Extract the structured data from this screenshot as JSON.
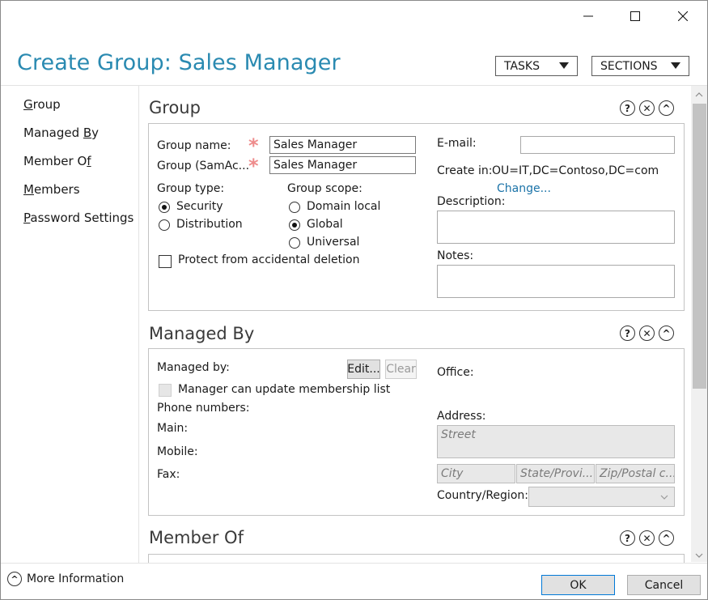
{
  "window": {
    "title": "Create Group: Sales Manager",
    "controls": {
      "minimize": "minimize",
      "maximize": "maximize",
      "close": "close"
    }
  },
  "toolbar": {
    "tasks_label": "TASKS",
    "sections_label": "SECTIONS"
  },
  "nav": {
    "items": [
      {
        "label": "Group",
        "access_key": "G"
      },
      {
        "label": "Managed By",
        "access_key": "B"
      },
      {
        "label": "Member Of",
        "access_key": "f"
      },
      {
        "label": "Members",
        "access_key": "M"
      },
      {
        "label": "Password Settings",
        "access_key": "P"
      }
    ]
  },
  "group_section": {
    "title": "Group",
    "group_name_label": "Group name:",
    "group_name_value": "Sales Manager",
    "samaccount_label": "Group (SamAc...",
    "samaccount_value": "Sales Manager",
    "group_type_label": "Group type:",
    "group_types": [
      "Security",
      "Distribution"
    ],
    "group_type_selected": "Security",
    "group_scope_label": "Group scope:",
    "group_scopes": [
      "Domain local",
      "Global",
      "Universal"
    ],
    "group_scope_selected": "Global",
    "protect_label": "Protect from accidental deletion",
    "protect_checked": false,
    "email_label": "E-mail:",
    "email_value": "",
    "create_in_label": "Create in:",
    "create_in_value": "OU=IT,DC=Contoso,DC=com",
    "change_link": "Change...",
    "description_label": "Description:",
    "notes_label": "Notes:"
  },
  "managed_by_section": {
    "title": "Managed By",
    "managed_by_label": "Managed by:",
    "edit_label": "Edit...",
    "clear_label": "Clear",
    "manager_update_label": "Manager can update membership list",
    "phone_numbers_label": "Phone numbers:",
    "main_label": "Main:",
    "mobile_label": "Mobile:",
    "fax_label": "Fax:",
    "office_label": "Office:",
    "address_label": "Address:",
    "street_placeholder": "Street",
    "city_placeholder": "City",
    "state_placeholder": "State/Provi...",
    "zip_placeholder": "Zip/Postal c...",
    "country_label": "Country/Region:"
  },
  "member_of_section": {
    "title": "Member Of"
  },
  "section_controls": {
    "help": "?",
    "close": "✕",
    "collapse": "^"
  },
  "footer": {
    "more_info": "More Information",
    "ok_label": "OK",
    "cancel_label": "Cancel"
  }
}
